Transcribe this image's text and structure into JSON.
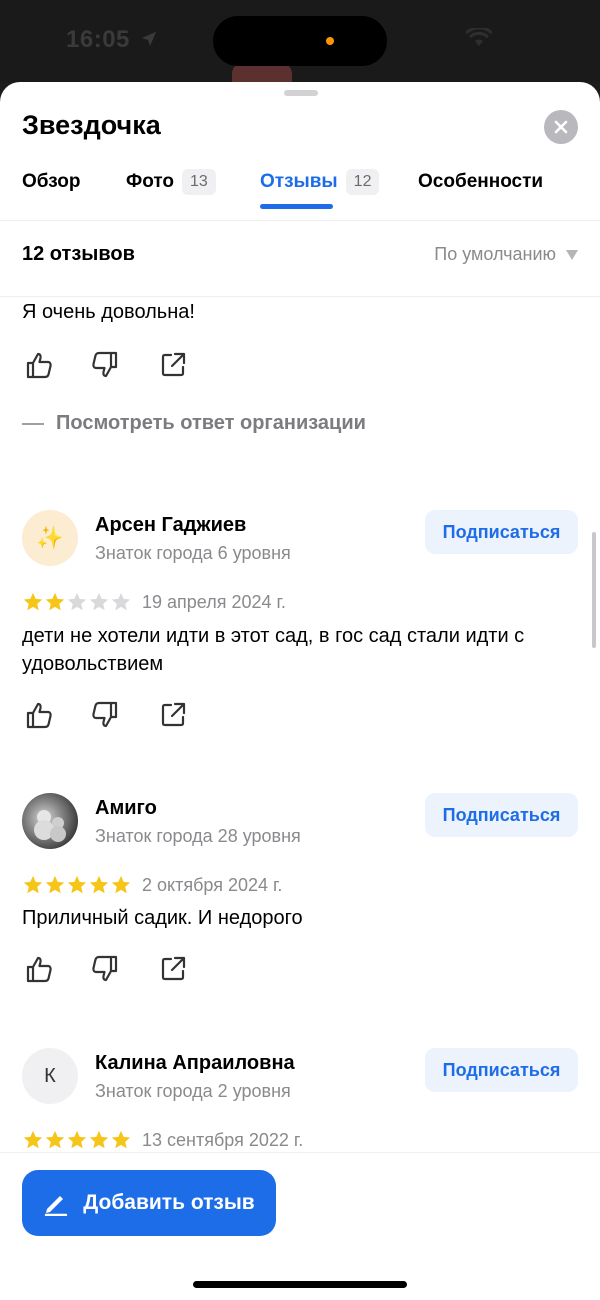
{
  "status_bar": {
    "time": "16:05"
  },
  "sheet": {
    "title": "Звездочка",
    "close_icon": "close-icon"
  },
  "tabs": [
    {
      "label": "Обзор"
    },
    {
      "label": "Фото",
      "count": "13"
    },
    {
      "label": "Отзывы",
      "count": "12",
      "active": true
    },
    {
      "label": "Особенности"
    }
  ],
  "reviews_header": {
    "count_label": "12 отзывов",
    "sort_label": "По умолчанию"
  },
  "partial_review": {
    "text": "Я очень довольна!",
    "org_reply_link": "Посмотреть ответ организации"
  },
  "reviews": [
    {
      "author": "Арсен Гаджиев",
      "level": "Знаток города 6 уровня",
      "subscribe_label": "Подписаться",
      "rating": 2,
      "date": "19 апреля 2024 г.",
      "text": "дети не хотели идти в этот сад, в гос сад стали идти с удовольствием",
      "avatar": "✨"
    },
    {
      "author": "Амиго",
      "level": "Знаток города 28 уровня",
      "subscribe_label": "Подписаться",
      "rating": 5,
      "date": "2 октября 2024 г.",
      "text": "Приличный садик. И недорого"
    },
    {
      "author": "Калина Апраиловна",
      "level": "Знаток города 2 уровня",
      "subscribe_label": "Подписаться",
      "rating": 5,
      "date": "13 сентября 2022 г.",
      "avatar_letter": "К"
    }
  ],
  "bottom": {
    "add_review_label": "Добавить отзыв"
  },
  "colors": {
    "accent": "#1e6de8",
    "star": "#f5c518",
    "star_empty": "#d9d9dc"
  }
}
